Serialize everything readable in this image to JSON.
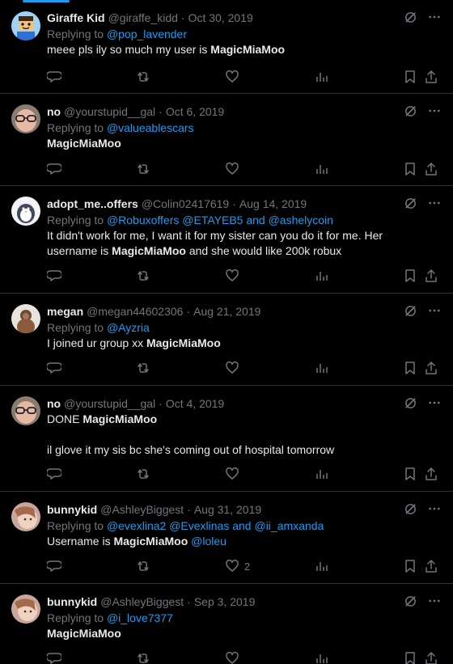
{
  "accent_color": "#1d9bf0",
  "tweets": [
    {
      "name": "Giraffe Kid",
      "handle": "@giraffe_kidd",
      "date": "Oct 30, 2019",
      "replying_prefix": "Replying to ",
      "replying_to": "@pop_lavender",
      "text_plain": "meee pls ily so much my user is ",
      "text_bold": "MagicMiaMoo",
      "likes": ""
    },
    {
      "name": "no",
      "handle": "@yourstupid__gal",
      "date": "Oct 6, 2019",
      "replying_prefix": "Replying to ",
      "replying_to": "@valueablescars",
      "text_bold": "MagicMiaMoo",
      "likes": ""
    },
    {
      "name": "adopt_me..offers",
      "handle": "@Colin02417619",
      "date": "Aug 14, 2019",
      "replying_prefix": "Replying to ",
      "replying_m1": "@Robuxoffers",
      "replying_m2": "@ETAYEB5",
      "replying_and": " and ",
      "replying_m3": "@ashelycoin",
      "text_line1": "It didn't work for me, I want it for my sister can you do it for me. Her",
      "text_line2_a": "username is ",
      "text_bold": "MagicMiaMoo",
      "text_line2_b": " and she would like 200k robux",
      "likes": ""
    },
    {
      "name": "megan",
      "handle": "@megan44602306",
      "date": "Aug 21, 2019",
      "replying_prefix": "Replying to ",
      "replying_to": "@Ayzria",
      "text_plain": "I joined ur group xx ",
      "text_bold": "MagicMiaMoo",
      "likes": ""
    },
    {
      "name": "no",
      "handle": "@yourstupid__gal",
      "date": "Oct 4, 2019",
      "text_plain": "DONE ",
      "text_bold": "MagicMiaMoo",
      "text_line3": "il glove it my sis bc she's coming out of hospital tomorrow",
      "likes": ""
    },
    {
      "name": "bunnykid",
      "handle": "@AshleyBiggest",
      "date": "Aug 31, 2019",
      "replying_prefix": "Replying to ",
      "replying_m1": "@evexlina2",
      "replying_m2": "@Evexlinas",
      "replying_and": " and ",
      "replying_m3": "@ii_amxanda",
      "text_plain": "Username is ",
      "text_bold": "MagicMiaMoo",
      "text_mention": "@loleu",
      "likes": "2"
    },
    {
      "name": "bunnykid",
      "handle": "@AshleyBiggest",
      "date": "Sep 3, 2019",
      "replying_prefix": "Replying to ",
      "replying_to": "@i_love7377",
      "text_bold": "MagicMiaMoo",
      "likes": ""
    }
  ],
  "icons": {
    "reply": "reply-icon",
    "retweet": "retweet-icon",
    "like": "like-icon",
    "views": "views-icon",
    "bookmark": "bookmark-icon",
    "share": "share-icon",
    "grok": "grok-icon",
    "more": "more-icon"
  }
}
